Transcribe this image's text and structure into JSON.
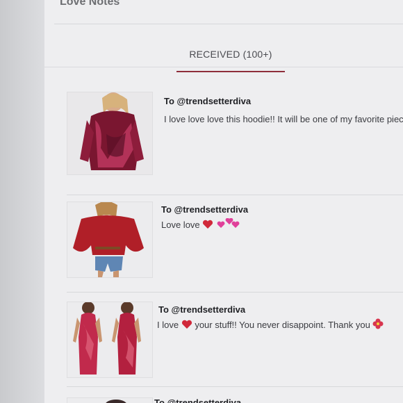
{
  "section": {
    "title": "Love Notes"
  },
  "tabs": [
    {
      "label": "RECEIVED (100+)"
    }
  ],
  "notes": [
    {
      "to": "To @trendsetterdiva",
      "message": "I love love love this hoodie!! It will be one of my favorite piec"
    },
    {
      "to": "To @trendsetterdiva",
      "message": "Love love"
    },
    {
      "to": "To @trendsetterdiva",
      "message_a": "I love",
      "message_b": "your stuff!! You never disappoint. Thank you"
    },
    {
      "to": "To @trendsetterdiva"
    }
  ],
  "colors": {
    "accent": "#8e2d3a",
    "heart": "#d0283a",
    "pink_hearts": "#e0409a"
  }
}
